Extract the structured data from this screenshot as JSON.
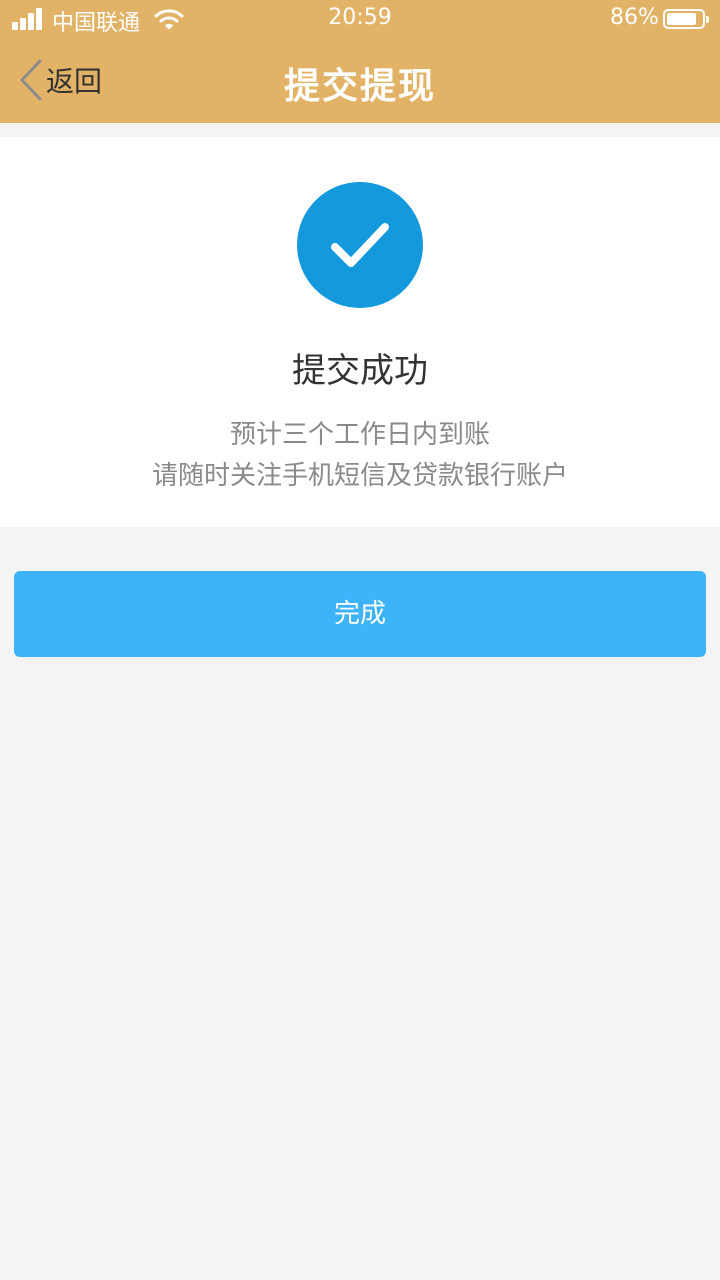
{
  "status_bar": {
    "carrier": "中国联通",
    "time": "20:59",
    "battery_percent": "86%",
    "battery_level": 0.86,
    "signal_icon": "signal-bars-icon",
    "wifi_icon": "wifi-icon",
    "battery_icon": "battery-icon"
  },
  "nav": {
    "back_label": "返回",
    "back_icon": "chevron-left-icon",
    "title": "提交提现"
  },
  "result": {
    "icon": "checkmark-circle-icon",
    "title": "提交成功",
    "line1": "预计三个工作日内到账",
    "line2": "请随时关注手机短信及贷款银行账户"
  },
  "actions": {
    "done_label": "完成"
  },
  "colors": {
    "header": "#e2b366",
    "success_icon": "#1399dc",
    "primary_button": "#3db3f9",
    "page_background": "#f4f4f4"
  }
}
